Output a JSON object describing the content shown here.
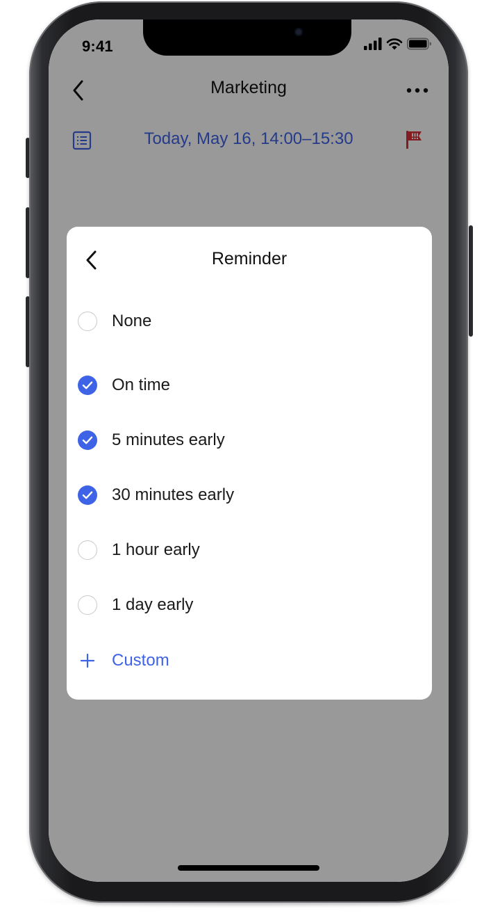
{
  "status_bar": {
    "time": "9:41"
  },
  "nav": {
    "title": "Marketing"
  },
  "event": {
    "date_range": "Today, May 16, 14:00–15:30"
  },
  "dialog": {
    "title": "Reminder",
    "options": [
      {
        "label": "None",
        "checked": false
      },
      {
        "label": "On time",
        "checked": true
      },
      {
        "label": "5 minutes early",
        "checked": true
      },
      {
        "label": "30 minutes early",
        "checked": true
      },
      {
        "label": "1 hour early",
        "checked": false
      },
      {
        "label": "1 day early",
        "checked": false
      }
    ],
    "custom_label": "Custom"
  },
  "colors": {
    "accent": "#3f63e6",
    "flag": "#d93036",
    "overlay": "rgba(0,0,0,0.40)"
  },
  "icons": {
    "nav_back": "chevron-left-icon",
    "nav_more": "more-horizontal-icon",
    "event_detail": "document-list-icon",
    "priority": "flag-icon",
    "dialog_back": "chevron-left-icon",
    "add_custom": "plus-icon",
    "check": "checkmark-icon"
  }
}
